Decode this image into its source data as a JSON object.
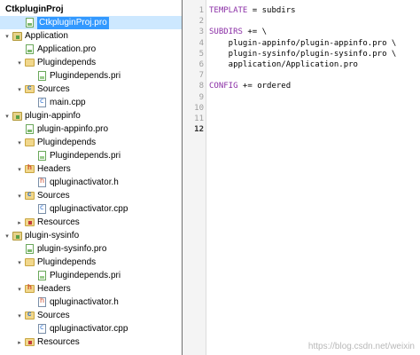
{
  "tree": [
    {
      "label": "CtkpluginProj",
      "level": 0,
      "arrow": "",
      "icon": "none",
      "bold": true
    },
    {
      "label": "CtkpluginProj.pro",
      "level": 1,
      "arrow": "",
      "icon": "pro",
      "selected": true
    },
    {
      "label": "Application",
      "level": 0,
      "arrow": "down",
      "icon": "folder-pro"
    },
    {
      "label": "Application.pro",
      "level": 1,
      "arrow": "",
      "icon": "pro"
    },
    {
      "label": "Plugindepends",
      "level": 1,
      "arrow": "down",
      "icon": "folder"
    },
    {
      "label": "Plugindepends.pri",
      "level": 2,
      "arrow": "",
      "icon": "pri"
    },
    {
      "label": "Sources",
      "level": 1,
      "arrow": "down",
      "icon": "folder-src"
    },
    {
      "label": "main.cpp",
      "level": 2,
      "arrow": "",
      "icon": "cpp"
    },
    {
      "label": "plugin-appinfo",
      "level": 0,
      "arrow": "down",
      "icon": "folder-pro"
    },
    {
      "label": "plugin-appinfo.pro",
      "level": 1,
      "arrow": "",
      "icon": "pro"
    },
    {
      "label": "Plugindepends",
      "level": 1,
      "arrow": "down",
      "icon": "folder"
    },
    {
      "label": "Plugindepends.pri",
      "level": 2,
      "arrow": "",
      "icon": "pri"
    },
    {
      "label": "Headers",
      "level": 1,
      "arrow": "down",
      "icon": "folder-hdr"
    },
    {
      "label": "qpluginactivator.h",
      "level": 2,
      "arrow": "",
      "icon": "h"
    },
    {
      "label": "Sources",
      "level": 1,
      "arrow": "down",
      "icon": "folder-src"
    },
    {
      "label": "qpluginactivator.cpp",
      "level": 2,
      "arrow": "",
      "icon": "cpp"
    },
    {
      "label": "Resources",
      "level": 1,
      "arrow": "right",
      "icon": "folder-res"
    },
    {
      "label": "plugin-sysinfo",
      "level": 0,
      "arrow": "down",
      "icon": "folder-pro"
    },
    {
      "label": "plugin-sysinfo.pro",
      "level": 1,
      "arrow": "",
      "icon": "pro"
    },
    {
      "label": "Plugindepends",
      "level": 1,
      "arrow": "down",
      "icon": "folder"
    },
    {
      "label": "Plugindepends.pri",
      "level": 2,
      "arrow": "",
      "icon": "pri"
    },
    {
      "label": "Headers",
      "level": 1,
      "arrow": "down",
      "icon": "folder-hdr"
    },
    {
      "label": "qpluginactivator.h",
      "level": 2,
      "arrow": "",
      "icon": "h"
    },
    {
      "label": "Sources",
      "level": 1,
      "arrow": "down",
      "icon": "folder-src"
    },
    {
      "label": "qpluginactivator.cpp",
      "level": 2,
      "arrow": "",
      "icon": "cpp"
    },
    {
      "label": "Resources",
      "level": 1,
      "arrow": "right",
      "icon": "folder-res"
    }
  ],
  "editor": {
    "current_line": 12,
    "lines": [
      {
        "n": "1",
        "kw": "TEMPLATE",
        "rest": " = subdirs"
      },
      {
        "n": "2",
        "kw": "",
        "rest": ""
      },
      {
        "n": "3",
        "kw": "SUBDIRS",
        "rest": " += \\"
      },
      {
        "n": "4",
        "kw": "",
        "rest": "    plugin-appinfo/plugin-appinfo.pro \\"
      },
      {
        "n": "5",
        "kw": "",
        "rest": "    plugin-sysinfo/plugin-sysinfo.pro \\"
      },
      {
        "n": "6",
        "kw": "",
        "rest": "    application/Application.pro"
      },
      {
        "n": "7",
        "kw": "",
        "rest": ""
      },
      {
        "n": "8",
        "kw": "CONFIG",
        "rest": " += ordered"
      },
      {
        "n": "9",
        "kw": "",
        "rest": ""
      },
      {
        "n": "10",
        "kw": "",
        "rest": ""
      },
      {
        "n": "11",
        "kw": "",
        "rest": ""
      },
      {
        "n": "12",
        "kw": "",
        "rest": ""
      }
    ]
  },
  "watermark": "https://blog.csdn.net/weixin"
}
